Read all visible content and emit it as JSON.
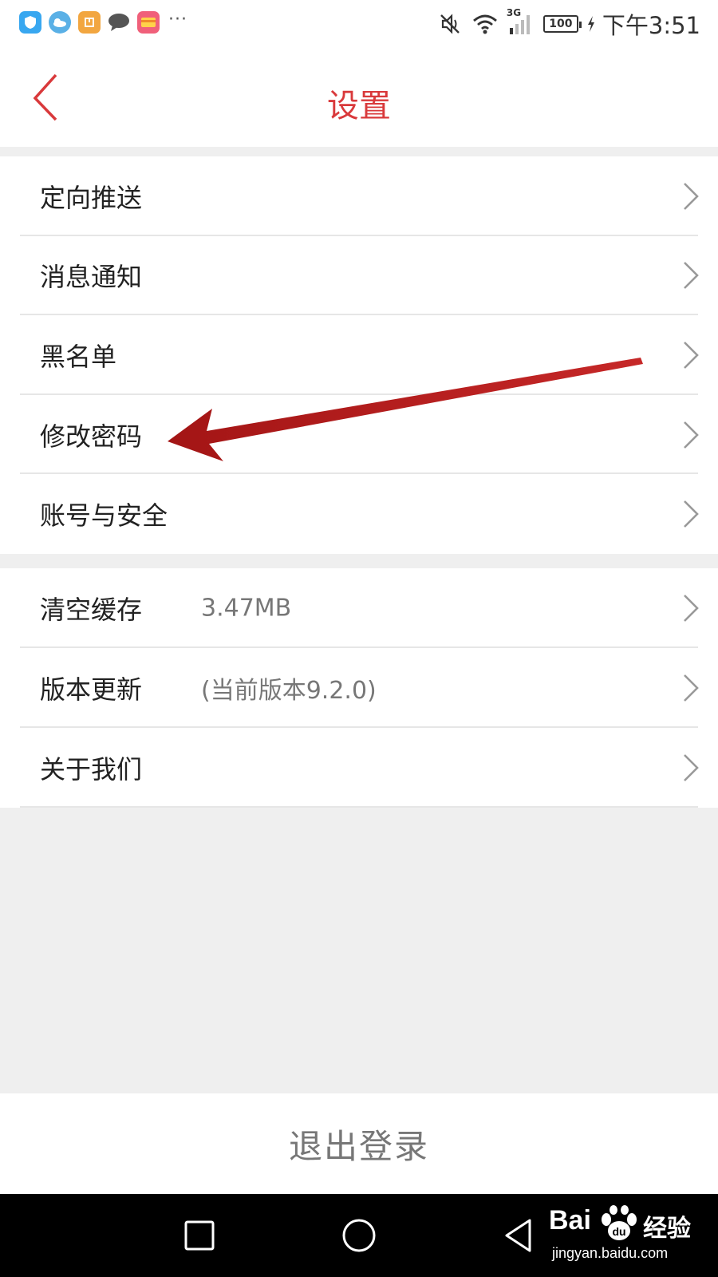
{
  "status_bar": {
    "app_icons": [
      "shield-app-icon",
      "weather-app-icon",
      "package-app-icon",
      "chat-app-icon",
      "wallet-app-icon"
    ],
    "more": "···",
    "network": "3G",
    "battery": "100",
    "time": "下午3:51"
  },
  "header": {
    "title": "设置",
    "back_icon": "chevron-left-icon",
    "accent_color": "#d9393b"
  },
  "settings_group1": [
    {
      "label": "定向推送"
    },
    {
      "label": "消息通知"
    },
    {
      "label": "黑名单"
    },
    {
      "label": "修改密码"
    },
    {
      "label": "账号与安全"
    }
  ],
  "settings_group2": [
    {
      "label": "清空缓存",
      "value": "3.47MB"
    },
    {
      "label": "版本更新",
      "value": "(当前版本9.2.0)"
    },
    {
      "label": "关于我们",
      "value": ""
    }
  ],
  "annotation": {
    "type": "red-arrow",
    "points_to": "修改密码",
    "color": "#b71c1c"
  },
  "logout": {
    "label": "退出登录"
  },
  "nav_bar": {
    "buttons": [
      "recent-apps-icon",
      "home-icon",
      "back-triangle-icon"
    ]
  },
  "watermark": {
    "brand": "Bai",
    "brand2": "经验",
    "url": "jingyan.baidu.com"
  }
}
